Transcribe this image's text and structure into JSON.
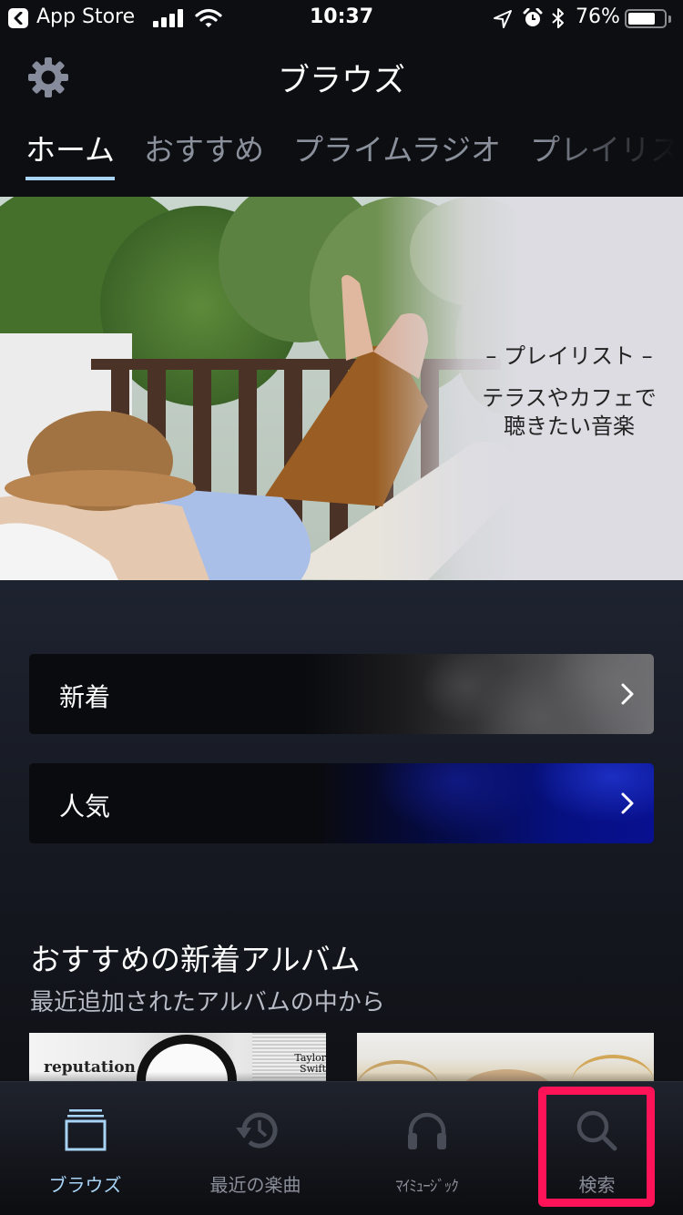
{
  "status_bar": {
    "back_app": "App Store",
    "time": "10:37",
    "battery_percent_label": "76%",
    "battery_level": 0.76,
    "signal_bars": 4,
    "icons": [
      "back-app-icon",
      "signal-icon",
      "wifi-icon",
      "location-icon",
      "alarm-icon",
      "bluetooth-icon",
      "battery-icon"
    ]
  },
  "header": {
    "title": "ブラウズ",
    "settings_icon": "gear-icon",
    "tabs": [
      {
        "label": "ホーム",
        "active": true
      },
      {
        "label": "おすすめ",
        "active": false
      },
      {
        "label": "プライムラジオ",
        "active": false
      },
      {
        "label": "プレイリスト",
        "active": false
      }
    ]
  },
  "hero": {
    "category": "– プレイリスト –",
    "line1": "テラスやカフェで",
    "line2": "聴きたい音楽"
  },
  "main": {
    "cards": [
      {
        "label": "新着",
        "icon": "chevron-right-icon"
      },
      {
        "label": "人気",
        "icon": "chevron-right-icon"
      }
    ],
    "section": {
      "title": "おすすめの新着アルバム",
      "subtitle": "最近追加されたアルバムの中から",
      "albums": [
        {
          "title_text": "reputation",
          "artist_text": "Taylor Swift"
        },
        {
          "title_text": "",
          "artist_text": ""
        }
      ]
    }
  },
  "tabbar": {
    "items": [
      {
        "label": "ブラウズ",
        "icon": "browse-icon",
        "active": true
      },
      {
        "label": "最近の楽曲",
        "icon": "history-icon",
        "active": false
      },
      {
        "label": "ﾏｲﾐｭｰｼﾞｯｸ",
        "icon": "headphones-icon",
        "active": false
      },
      {
        "label": "検索",
        "icon": "search-icon",
        "active": false
      }
    ],
    "highlighted_item": "検索"
  },
  "colors": {
    "background": "#0d0e11",
    "accent": "#a8d4f6",
    "inactive_text": "#8a909c",
    "highlight_box": "#fe1258"
  }
}
